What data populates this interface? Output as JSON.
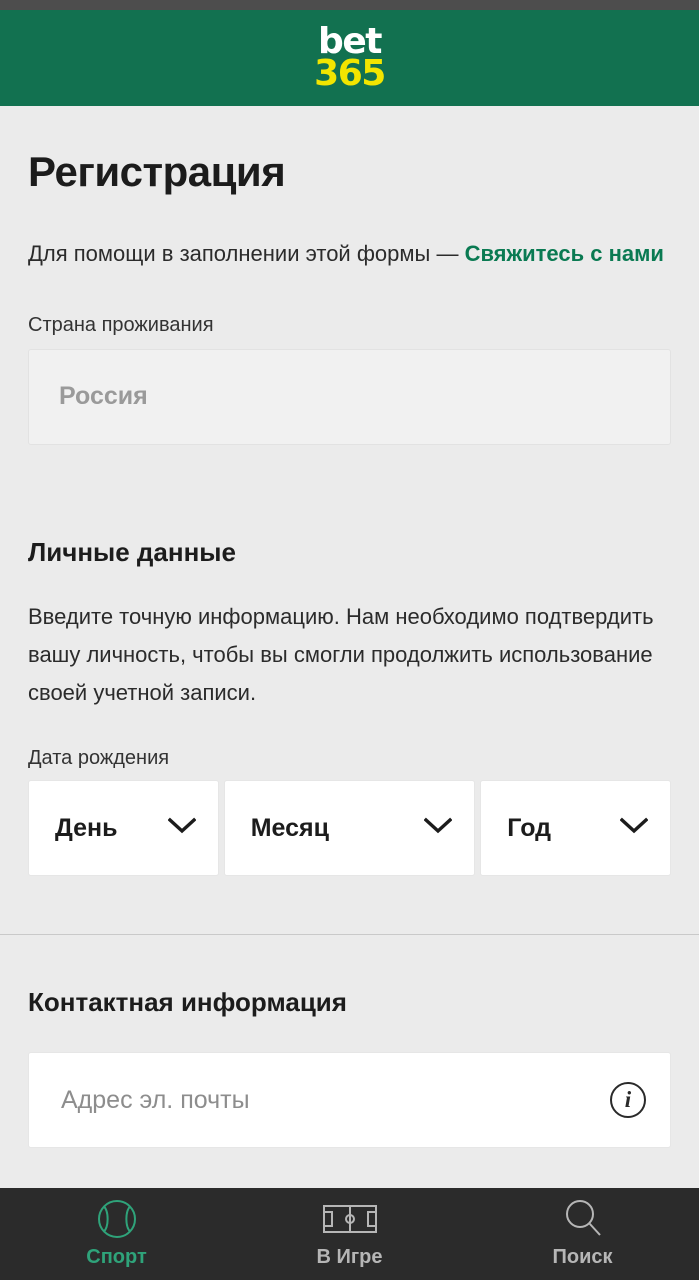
{
  "header": {
    "logo_top": "bet",
    "logo_bottom": "365",
    "brand_green": "#127150",
    "logo_yellow": "#f2e500"
  },
  "registration": {
    "page_title": "Регистрация",
    "help_prefix": "Для помощи в заполнении этой формы — ",
    "help_link": "Свяжитесь с нами",
    "help_link_color": "#0a7a52",
    "country": {
      "label": "Страна проживания",
      "value": "Россия"
    },
    "personal": {
      "title": "Личные данные",
      "description": "Введите точную информацию. Нам необходимо подтвердить вашу личность, чтобы вы смогли продолжить использование своей учетной записи.",
      "dob_label": "Дата рождения",
      "dob_fields": [
        {
          "name": "day",
          "value": "День"
        },
        {
          "name": "month",
          "value": "Месяц"
        },
        {
          "name": "year",
          "value": "Год"
        }
      ]
    },
    "contact": {
      "title": "Контактная информация",
      "email_placeholder": "Адрес эл. почты",
      "email_value": "",
      "info_glyph": "i"
    }
  },
  "bottom_nav": {
    "items": [
      {
        "label": "Спорт",
        "icon": "sports-ball-icon",
        "active": true
      },
      {
        "label": "В Игре",
        "icon": "football-pitch-icon",
        "active": false
      },
      {
        "label": "Поиск",
        "icon": "search-icon",
        "active": false
      }
    ],
    "active_color": "#2fa37a",
    "inactive_color": "#b6b6b6"
  }
}
